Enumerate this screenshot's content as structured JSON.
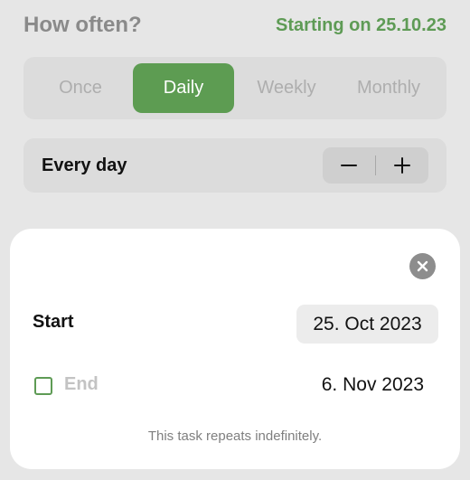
{
  "header": {
    "title": "How often?",
    "starting_text": "Starting on 25.10.23"
  },
  "frequency": {
    "options": [
      "Once",
      "Daily",
      "Weekly",
      "Monthly"
    ],
    "selected": "Daily"
  },
  "interval": {
    "label": "Every day",
    "decrement_icon": "minus-icon",
    "increment_icon": "plus-icon"
  },
  "date_sheet": {
    "close_icon": "close-icon",
    "start_label": "Start",
    "start_date": "25. Oct 2023",
    "end_label": "End",
    "end_checked": false,
    "end_date": "6. Nov 2023",
    "note": "This task repeats indefinitely."
  },
  "colors": {
    "accent_green": "#5d9c52",
    "background": "#e6e6e6"
  }
}
